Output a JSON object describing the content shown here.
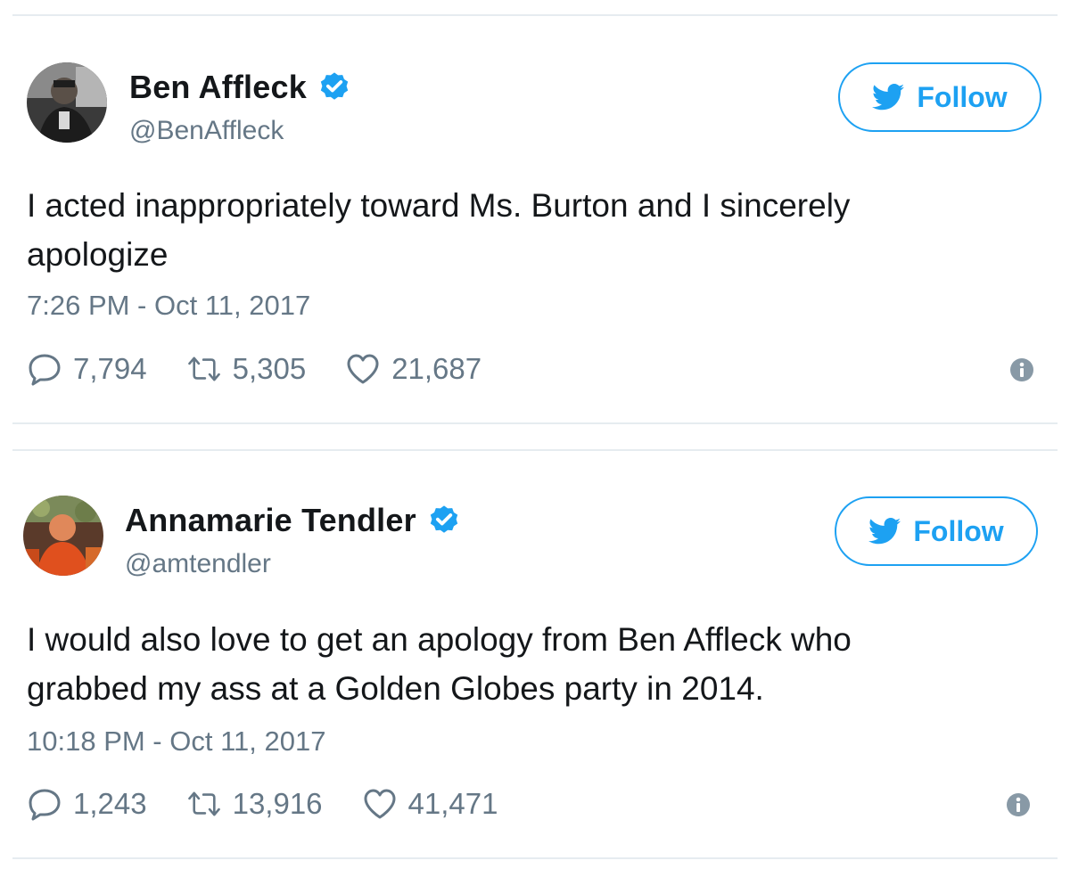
{
  "colors": {
    "accent": "#1da1f2",
    "text": "#14171a",
    "muted": "#657786",
    "divider": "#e6ecf0"
  },
  "tweets": [
    {
      "name": "Ben Affleck",
      "handle": "@BenAffleck",
      "verified": true,
      "follow_label": "Follow",
      "text_lines": [
        "I acted inappropriately toward Ms. Burton and I sincerely",
        "apologize"
      ],
      "timestamp": "7:26 PM - Oct 11, 2017",
      "replies": "7,794",
      "retweets": "5,305",
      "likes": "21,687",
      "icons": [
        "reply-icon",
        "retweet-icon",
        "heart-icon",
        "info-icon",
        "verified-icon",
        "twitter-bird-icon"
      ]
    },
    {
      "name": "Annamarie Tendler",
      "handle": "@amtendler",
      "verified": true,
      "follow_label": "Follow",
      "text_lines": [
        "I would also love to get an apology from Ben Affleck who",
        "grabbed my ass at a Golden Globes party in 2014."
      ],
      "timestamp": "10:18 PM - Oct 11, 2017",
      "replies": "1,243",
      "retweets": "13,916",
      "likes": "41,471",
      "icons": [
        "reply-icon",
        "retweet-icon",
        "heart-icon",
        "info-icon",
        "verified-icon",
        "twitter-bird-icon"
      ]
    }
  ]
}
